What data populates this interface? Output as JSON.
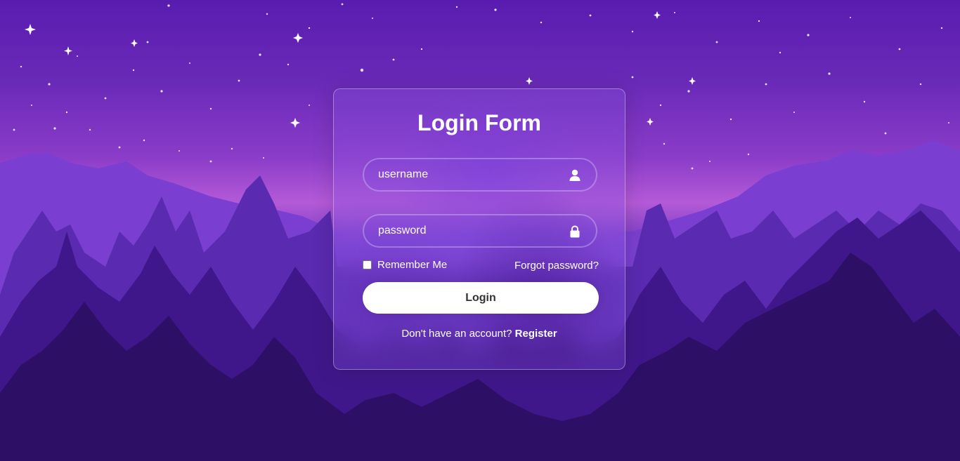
{
  "form": {
    "title": "Login Form",
    "username_placeholder": "username",
    "password_placeholder": "password",
    "remember_label": "Remember Me",
    "forgot_label": "Forgot password?",
    "login_label": "Login",
    "register_prompt": "Don't have an account?",
    "register_label": "Register"
  },
  "icons": {
    "username": "user-icon",
    "password": "lock-icon"
  },
  "colors": {
    "sky_top": "#5a1cb0",
    "horizon_glow": "#b45ad8",
    "trees_dark": "#2e0f66",
    "button_bg": "#ffffff",
    "button_text": "#333333",
    "text": "#ffffff"
  }
}
